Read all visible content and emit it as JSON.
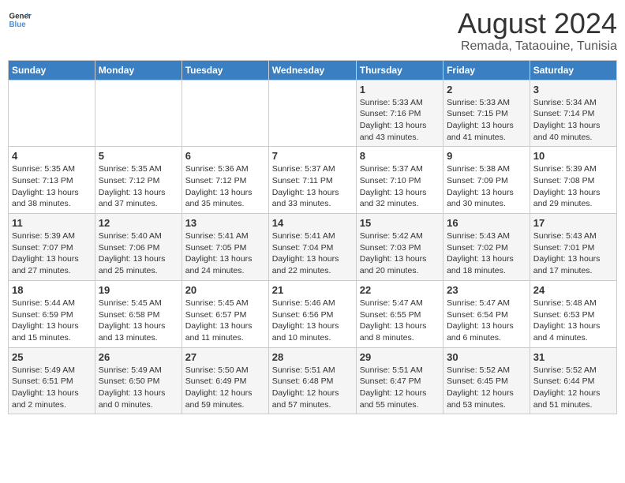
{
  "logo": {
    "text_general": "General",
    "text_blue": "Blue"
  },
  "title": "August 2024",
  "subtitle": "Remada, Tataouine, Tunisia",
  "headers": [
    "Sunday",
    "Monday",
    "Tuesday",
    "Wednesday",
    "Thursday",
    "Friday",
    "Saturday"
  ],
  "weeks": [
    [
      {
        "day": "",
        "sunrise": "",
        "sunset": "",
        "daylight": ""
      },
      {
        "day": "",
        "sunrise": "",
        "sunset": "",
        "daylight": ""
      },
      {
        "day": "",
        "sunrise": "",
        "sunset": "",
        "daylight": ""
      },
      {
        "day": "",
        "sunrise": "",
        "sunset": "",
        "daylight": ""
      },
      {
        "day": "1",
        "sunrise": "Sunrise: 5:33 AM",
        "sunset": "Sunset: 7:16 PM",
        "daylight": "Daylight: 13 hours and 43 minutes."
      },
      {
        "day": "2",
        "sunrise": "Sunrise: 5:33 AM",
        "sunset": "Sunset: 7:15 PM",
        "daylight": "Daylight: 13 hours and 41 minutes."
      },
      {
        "day": "3",
        "sunrise": "Sunrise: 5:34 AM",
        "sunset": "Sunset: 7:14 PM",
        "daylight": "Daylight: 13 hours and 40 minutes."
      }
    ],
    [
      {
        "day": "4",
        "sunrise": "Sunrise: 5:35 AM",
        "sunset": "Sunset: 7:13 PM",
        "daylight": "Daylight: 13 hours and 38 minutes."
      },
      {
        "day": "5",
        "sunrise": "Sunrise: 5:35 AM",
        "sunset": "Sunset: 7:12 PM",
        "daylight": "Daylight: 13 hours and 37 minutes."
      },
      {
        "day": "6",
        "sunrise": "Sunrise: 5:36 AM",
        "sunset": "Sunset: 7:12 PM",
        "daylight": "Daylight: 13 hours and 35 minutes."
      },
      {
        "day": "7",
        "sunrise": "Sunrise: 5:37 AM",
        "sunset": "Sunset: 7:11 PM",
        "daylight": "Daylight: 13 hours and 33 minutes."
      },
      {
        "day": "8",
        "sunrise": "Sunrise: 5:37 AM",
        "sunset": "Sunset: 7:10 PM",
        "daylight": "Daylight: 13 hours and 32 minutes."
      },
      {
        "day": "9",
        "sunrise": "Sunrise: 5:38 AM",
        "sunset": "Sunset: 7:09 PM",
        "daylight": "Daylight: 13 hours and 30 minutes."
      },
      {
        "day": "10",
        "sunrise": "Sunrise: 5:39 AM",
        "sunset": "Sunset: 7:08 PM",
        "daylight": "Daylight: 13 hours and 29 minutes."
      }
    ],
    [
      {
        "day": "11",
        "sunrise": "Sunrise: 5:39 AM",
        "sunset": "Sunset: 7:07 PM",
        "daylight": "Daylight: 13 hours and 27 minutes."
      },
      {
        "day": "12",
        "sunrise": "Sunrise: 5:40 AM",
        "sunset": "Sunset: 7:06 PM",
        "daylight": "Daylight: 13 hours and 25 minutes."
      },
      {
        "day": "13",
        "sunrise": "Sunrise: 5:41 AM",
        "sunset": "Sunset: 7:05 PM",
        "daylight": "Daylight: 13 hours and 24 minutes."
      },
      {
        "day": "14",
        "sunrise": "Sunrise: 5:41 AM",
        "sunset": "Sunset: 7:04 PM",
        "daylight": "Daylight: 13 hours and 22 minutes."
      },
      {
        "day": "15",
        "sunrise": "Sunrise: 5:42 AM",
        "sunset": "Sunset: 7:03 PM",
        "daylight": "Daylight: 13 hours and 20 minutes."
      },
      {
        "day": "16",
        "sunrise": "Sunrise: 5:43 AM",
        "sunset": "Sunset: 7:02 PM",
        "daylight": "Daylight: 13 hours and 18 minutes."
      },
      {
        "day": "17",
        "sunrise": "Sunrise: 5:43 AM",
        "sunset": "Sunset: 7:01 PM",
        "daylight": "Daylight: 13 hours and 17 minutes."
      }
    ],
    [
      {
        "day": "18",
        "sunrise": "Sunrise: 5:44 AM",
        "sunset": "Sunset: 6:59 PM",
        "daylight": "Daylight: 13 hours and 15 minutes."
      },
      {
        "day": "19",
        "sunrise": "Sunrise: 5:45 AM",
        "sunset": "Sunset: 6:58 PM",
        "daylight": "Daylight: 13 hours and 13 minutes."
      },
      {
        "day": "20",
        "sunrise": "Sunrise: 5:45 AM",
        "sunset": "Sunset: 6:57 PM",
        "daylight": "Daylight: 13 hours and 11 minutes."
      },
      {
        "day": "21",
        "sunrise": "Sunrise: 5:46 AM",
        "sunset": "Sunset: 6:56 PM",
        "daylight": "Daylight: 13 hours and 10 minutes."
      },
      {
        "day": "22",
        "sunrise": "Sunrise: 5:47 AM",
        "sunset": "Sunset: 6:55 PM",
        "daylight": "Daylight: 13 hours and 8 minutes."
      },
      {
        "day": "23",
        "sunrise": "Sunrise: 5:47 AM",
        "sunset": "Sunset: 6:54 PM",
        "daylight": "Daylight: 13 hours and 6 minutes."
      },
      {
        "day": "24",
        "sunrise": "Sunrise: 5:48 AM",
        "sunset": "Sunset: 6:53 PM",
        "daylight": "Daylight: 13 hours and 4 minutes."
      }
    ],
    [
      {
        "day": "25",
        "sunrise": "Sunrise: 5:49 AM",
        "sunset": "Sunset: 6:51 PM",
        "daylight": "Daylight: 13 hours and 2 minutes."
      },
      {
        "day": "26",
        "sunrise": "Sunrise: 5:49 AM",
        "sunset": "Sunset: 6:50 PM",
        "daylight": "Daylight: 13 hours and 0 minutes."
      },
      {
        "day": "27",
        "sunrise": "Sunrise: 5:50 AM",
        "sunset": "Sunset: 6:49 PM",
        "daylight": "Daylight: 12 hours and 59 minutes."
      },
      {
        "day": "28",
        "sunrise": "Sunrise: 5:51 AM",
        "sunset": "Sunset: 6:48 PM",
        "daylight": "Daylight: 12 hours and 57 minutes."
      },
      {
        "day": "29",
        "sunrise": "Sunrise: 5:51 AM",
        "sunset": "Sunset: 6:47 PM",
        "daylight": "Daylight: 12 hours and 55 minutes."
      },
      {
        "day": "30",
        "sunrise": "Sunrise: 5:52 AM",
        "sunset": "Sunset: 6:45 PM",
        "daylight": "Daylight: 12 hours and 53 minutes."
      },
      {
        "day": "31",
        "sunrise": "Sunrise: 5:52 AM",
        "sunset": "Sunset: 6:44 PM",
        "daylight": "Daylight: 12 hours and 51 minutes."
      }
    ]
  ]
}
